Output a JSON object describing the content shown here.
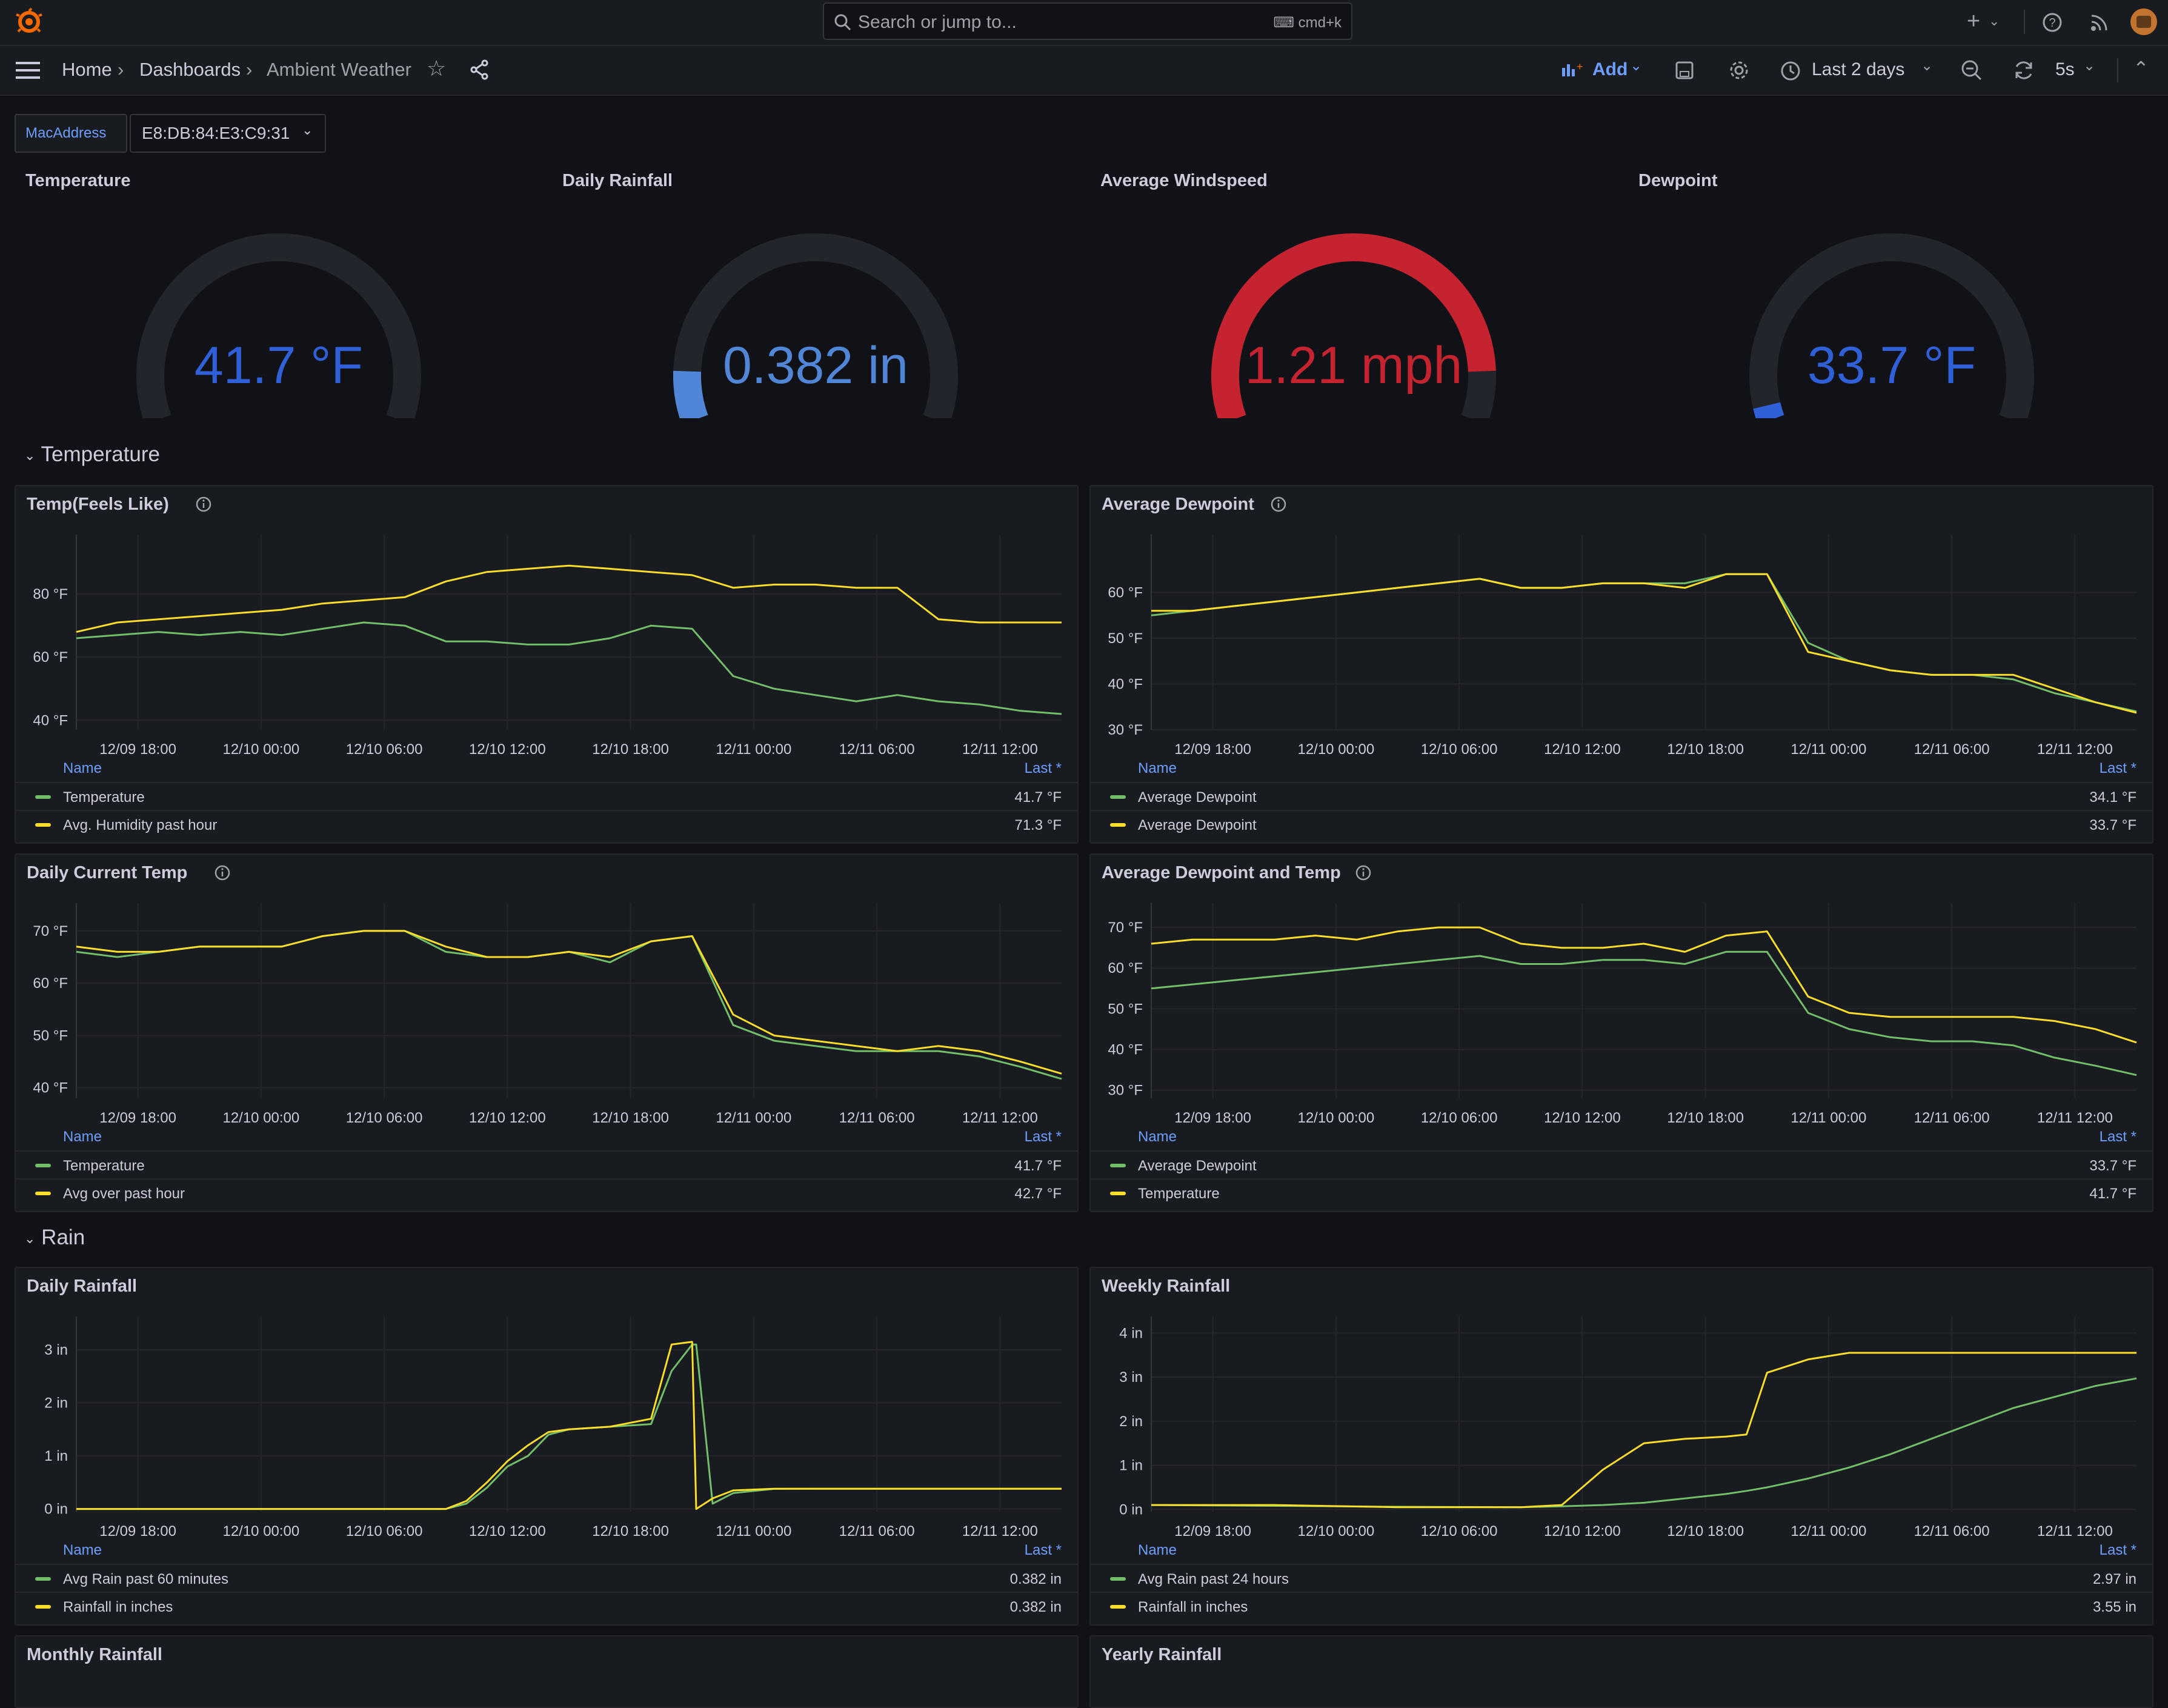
{
  "header": {
    "search_placeholder": "Search or jump to...",
    "search_shortcut": "cmd+k",
    "breadcrumb": [
      "Home",
      "Dashboards",
      "Ambient Weather"
    ],
    "add_label": "Add",
    "time_range": "Last 2 days",
    "refresh_interval": "5s"
  },
  "variables": {
    "label": "MacAddress",
    "value": "E8:DB:84:E3:C9:31"
  },
  "gauges": [
    {
      "title": "Temperature",
      "value": "41.7 °F",
      "fraction": 0.0,
      "color": "#2f60d8"
    },
    {
      "title": "Daily Rainfall",
      "value": "0.382 in",
      "fraction": 0.1,
      "color": "#5186d6"
    },
    {
      "title": "Average Windspeed",
      "value": "1.21 mph",
      "fraction": 0.9,
      "color": "#c4232f"
    },
    {
      "title": "Dewpoint",
      "value": "33.7 °F",
      "fraction": 0.03,
      "color": "#2f60d8"
    }
  ],
  "sections": {
    "temperature": "Temperature",
    "rain": "Rain"
  },
  "legend_headers": {
    "name": "Name",
    "last": "Last *"
  },
  "colors": {
    "green": "#73bf69",
    "yellow": "#fade2a",
    "grid": "#24262c",
    "axis_text": "#ccccdc"
  },
  "x_ticks": [
    "12/09 18:00",
    "12/10 00:00",
    "12/10 06:00",
    "12/10 12:00",
    "12/10 18:00",
    "12/11 00:00",
    "12/11 06:00",
    "12/11 12:00"
  ],
  "panels": [
    {
      "title": "Temp(Feels Like)",
      "info": true,
      "legend": [
        {
          "name": "Temperature",
          "last": "41.7 °F",
          "color": "green"
        },
        {
          "name": "Avg. Humidity past hour",
          "last": "71.3 °F",
          "color": "yellow"
        }
      ]
    },
    {
      "title": "Average Dewpoint",
      "info": true,
      "legend": [
        {
          "name": "Average Dewpoint",
          "last": "34.1 °F",
          "color": "green"
        },
        {
          "name": "Average Dewpoint",
          "last": "33.7 °F",
          "color": "yellow"
        }
      ]
    },
    {
      "title": "Daily Current Temp",
      "info": true,
      "legend": [
        {
          "name": "Temperature",
          "last": "41.7 °F",
          "color": "green"
        },
        {
          "name": "Avg over past hour",
          "last": "42.7 °F",
          "color": "yellow"
        }
      ]
    },
    {
      "title": "Average Dewpoint and Temp",
      "info": true,
      "legend": [
        {
          "name": "Average Dewpoint",
          "last": "33.7 °F",
          "color": "green"
        },
        {
          "name": "Temperature",
          "last": "41.7 °F",
          "color": "yellow"
        }
      ]
    },
    {
      "title": "Daily Rainfall",
      "info": false,
      "legend": [
        {
          "name": "Avg Rain past 60 minutes",
          "last": "0.382 in",
          "color": "green"
        },
        {
          "name": "Rainfall in inches",
          "last": "0.382 in",
          "color": "yellow"
        }
      ]
    },
    {
      "title": "Weekly Rainfall",
      "info": false,
      "legend": [
        {
          "name": "Avg Rain past 24 hours",
          "last": "2.97 in",
          "color": "green"
        },
        {
          "name": "Rainfall in inches",
          "last": "3.55 in",
          "color": "yellow"
        }
      ]
    },
    {
      "title": "Monthly Rainfall",
      "info": false,
      "legend": []
    },
    {
      "title": "Yearly Rainfall",
      "info": false,
      "legend": []
    }
  ],
  "chart_data": [
    {
      "type": "line",
      "title": "Temp(Feels Like)",
      "x_start": "12/09 15:00",
      "x_end": "12/11 15:00",
      "y_ticks": [
        "40 °F",
        "60 °F",
        "80 °F"
      ],
      "ylim": [
        37,
        95
      ],
      "x": [
        0,
        2,
        4,
        6,
        8,
        10,
        12,
        14,
        16,
        18,
        20,
        22,
        24,
        26,
        28,
        30,
        32,
        34,
        36,
        38,
        40,
        42,
        44,
        46,
        48
      ],
      "series": [
        {
          "name": "Temperature",
          "color": "green",
          "values": [
            66,
            67,
            68,
            67,
            68,
            67,
            69,
            71,
            70,
            65,
            65,
            64,
            64,
            66,
            70,
            69,
            54,
            50,
            48,
            46,
            48,
            46,
            45,
            43,
            42
          ]
        },
        {
          "name": "Avg. Humidity past hour",
          "color": "yellow",
          "values": [
            68,
            71,
            72,
            73,
            74,
            75,
            77,
            78,
            79,
            84,
            87,
            88,
            89,
            88,
            87,
            86,
            82,
            83,
            83,
            82,
            82,
            72,
            71,
            71,
            71
          ]
        }
      ]
    },
    {
      "type": "line",
      "title": "Average Dewpoint",
      "x_start": "12/09 15:00",
      "x_end": "12/11 15:00",
      "y_ticks": [
        "30 °F",
        "40 °F",
        "50 °F",
        "60 °F"
      ],
      "ylim": [
        30,
        70
      ],
      "x": [
        0,
        2,
        4,
        6,
        8,
        10,
        12,
        14,
        16,
        18,
        20,
        22,
        24,
        26,
        28,
        30,
        32,
        34,
        36,
        38,
        40,
        42,
        44,
        46,
        48
      ],
      "series": [
        {
          "name": "Average Dewpoint",
          "color": "green",
          "values": [
            55,
            56,
            57,
            58,
            59,
            60,
            61,
            62,
            63,
            61,
            61,
            62,
            62,
            62,
            64,
            64,
            49,
            45,
            43,
            42,
            42,
            41,
            38,
            36,
            34
          ]
        },
        {
          "name": "Average Dewpoint",
          "color": "yellow",
          "values": [
            56,
            56,
            57,
            58,
            59,
            60,
            61,
            62,
            63,
            61,
            61,
            62,
            62,
            61,
            64,
            64,
            47,
            45,
            43,
            42,
            42,
            42,
            39,
            36,
            33.7
          ]
        }
      ]
    },
    {
      "type": "line",
      "title": "Daily Current Temp",
      "x_start": "12/09 15:00",
      "x_end": "12/11 15:00",
      "y_ticks": [
        "40 °F",
        "50 °F",
        "60 °F",
        "70 °F"
      ],
      "ylim": [
        38,
        73
      ],
      "x": [
        0,
        2,
        4,
        6,
        8,
        10,
        12,
        14,
        16,
        18,
        20,
        22,
        24,
        26,
        28,
        30,
        32,
        34,
        36,
        38,
        40,
        42,
        44,
        46,
        48
      ],
      "series": [
        {
          "name": "Temperature",
          "color": "green",
          "values": [
            66,
            65,
            66,
            67,
            67,
            67,
            69,
            70,
            70,
            66,
            65,
            65,
            66,
            64,
            68,
            69,
            52,
            49,
            48,
            47,
            47,
            47,
            46,
            44,
            41.7
          ]
        },
        {
          "name": "Avg over past hour",
          "color": "yellow",
          "values": [
            67,
            66,
            66,
            67,
            67,
            67,
            69,
            70,
            70,
            67,
            65,
            65,
            66,
            65,
            68,
            69,
            54,
            50,
            49,
            48,
            47,
            48,
            47,
            45,
            42.7
          ]
        }
      ]
    },
    {
      "type": "line",
      "title": "Average Dewpoint and Temp",
      "x_start": "12/09 15:00",
      "x_end": "12/11 15:00",
      "y_ticks": [
        "30 °F",
        "40 °F",
        "50 °F",
        "60 °F",
        "70 °F"
      ],
      "ylim": [
        28,
        73
      ],
      "x": [
        0,
        2,
        4,
        6,
        8,
        10,
        12,
        14,
        16,
        18,
        20,
        22,
        24,
        26,
        28,
        30,
        32,
        34,
        36,
        38,
        40,
        42,
        44,
        46,
        48
      ],
      "series": [
        {
          "name": "Average Dewpoint",
          "color": "green",
          "values": [
            55,
            56,
            57,
            58,
            59,
            60,
            61,
            62,
            63,
            61,
            61,
            62,
            62,
            61,
            64,
            64,
            49,
            45,
            43,
            42,
            42,
            41,
            38,
            36,
            33.7
          ]
        },
        {
          "name": "Temperature",
          "color": "yellow",
          "values": [
            66,
            67,
            67,
            67,
            68,
            67,
            69,
            70,
            70,
            66,
            65,
            65,
            66,
            64,
            68,
            69,
            53,
            49,
            48,
            48,
            48,
            48,
            47,
            45,
            41.7
          ]
        }
      ]
    },
    {
      "type": "line",
      "title": "Daily Rainfall",
      "x_start": "12/09 15:00",
      "x_end": "12/11 15:00",
      "y_ticks": [
        "0 in",
        "1 in",
        "2 in",
        "3 in"
      ],
      "ylim": [
        -0.05,
        3.4
      ],
      "x": [
        0,
        4,
        8,
        12,
        16,
        18,
        19,
        20,
        21,
        22,
        23,
        24,
        26,
        28,
        29,
        30,
        30.2,
        31,
        32,
        34,
        36,
        40,
        44,
        48
      ],
      "series": [
        {
          "name": "Avg Rain past 60 minutes",
          "color": "green",
          "values": [
            0,
            0,
            0,
            0,
            0,
            0,
            0.1,
            0.4,
            0.8,
            1.0,
            1.4,
            1.5,
            1.55,
            1.6,
            2.6,
            3.1,
            3.1,
            0.1,
            0.3,
            0.38,
            0.382,
            0.382,
            0.382,
            0.382
          ]
        },
        {
          "name": "Rainfall in inches",
          "color": "yellow",
          "values": [
            0,
            0,
            0,
            0,
            0,
            0,
            0.15,
            0.5,
            0.9,
            1.2,
            1.45,
            1.5,
            1.55,
            1.7,
            3.1,
            3.15,
            0,
            0.2,
            0.35,
            0.382,
            0.382,
            0.382,
            0.382,
            0.382
          ]
        }
      ]
    },
    {
      "type": "line",
      "title": "Weekly Rainfall",
      "x_start": "12/09 15:00",
      "x_end": "12/11 15:00",
      "y_ticks": [
        "0 in",
        "1 in",
        "2 in",
        "3 in",
        "4 in"
      ],
      "ylim": [
        -0.05,
        4.1
      ],
      "x": [
        0,
        6,
        12,
        18,
        20,
        22,
        24,
        26,
        28,
        29,
        30,
        32,
        34,
        36,
        38,
        40,
        42,
        44,
        46,
        48
      ],
      "series": [
        {
          "name": "Avg Rain past 24 hours",
          "color": "green",
          "values": [
            0.1,
            0.08,
            0.06,
            0.05,
            0.07,
            0.1,
            0.15,
            0.25,
            0.35,
            0.42,
            0.5,
            0.7,
            0.95,
            1.25,
            1.6,
            1.95,
            2.3,
            2.55,
            2.8,
            2.97
          ]
        },
        {
          "name": "Rainfall in inches",
          "color": "yellow",
          "values": [
            0.1,
            0.1,
            0.05,
            0.05,
            0.1,
            0.9,
            1.5,
            1.6,
            1.65,
            1.7,
            3.1,
            3.4,
            3.55,
            3.55,
            3.55,
            3.55,
            3.55,
            3.55,
            3.55,
            3.55
          ]
        }
      ]
    }
  ]
}
